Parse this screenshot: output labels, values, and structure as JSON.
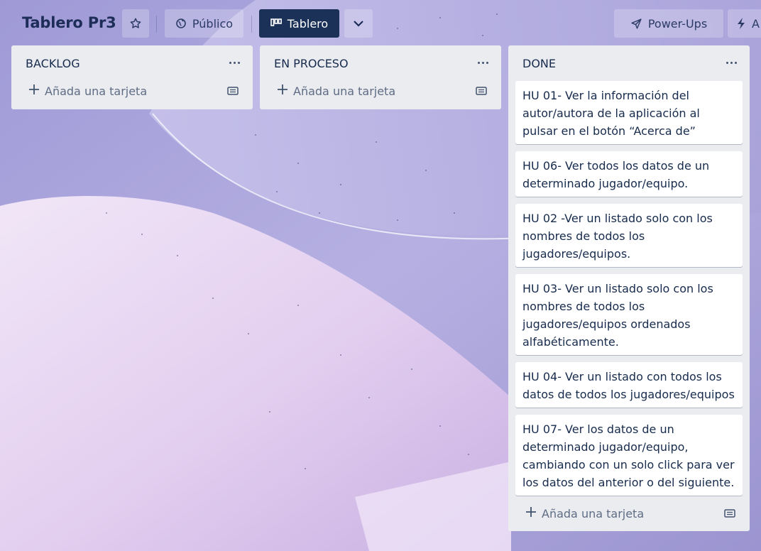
{
  "header": {
    "board_title": "Tablero Pr3",
    "star_icon": "star-icon",
    "visibility_label": "Público",
    "visibility_icon": "globe-icon",
    "view_label": "Tablero",
    "view_icon": "board-icon",
    "view_dropdown_icon": "chevron-down-icon",
    "powerups_label": "Power-Ups",
    "powerups_icon": "rocket-icon",
    "automation_label": "A",
    "automation_icon": "lightning-icon"
  },
  "lists": [
    {
      "title": "BACKLOG",
      "cards": [],
      "add_card_label": "Añada una tarjeta"
    },
    {
      "title": "EN PROCESO",
      "cards": [],
      "add_card_label": "Añada una tarjeta"
    },
    {
      "title": "DONE",
      "cards": [
        "HU 01- Ver la información del autor/autora de la aplicación al pulsar en el botón “Acerca de”",
        "HU 06- Ver todos los datos de un determinado jugador/equipo.",
        "HU 02 -Ver un listado solo con los nombres de todos los jugadores/equipos.",
        "HU 03- Ver un listado solo con los nombres de todos los jugadores/equipos ordenados alfabéticamente.",
        "HU 04- Ver un listado con todos los datos de todos los jugadores/equipos",
        "HU 07- Ver los datos de un determinado jugador/equipo, cambiando con un solo click para ver los datos del anterior o del siguiente."
      ],
      "add_card_label": "Añada una tarjeta"
    }
  ],
  "colors": {
    "header_dark_button": "#1b3157",
    "list_background": "#ebecf0",
    "card_background": "#ffffff",
    "text": "#172b4d"
  }
}
